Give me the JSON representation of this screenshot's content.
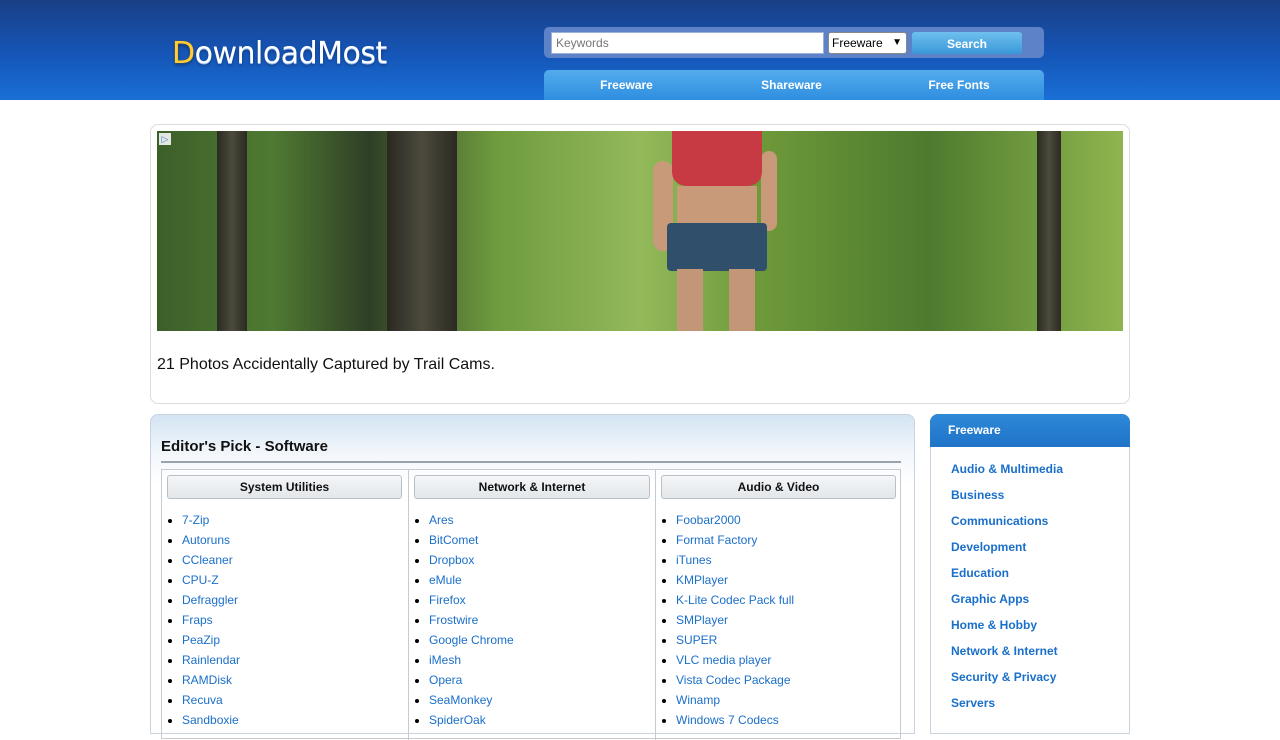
{
  "header": {
    "logo_text": "DownloadMost",
    "search": {
      "placeholder": "Keywords",
      "select_value": "Freeware",
      "button_label": "Search"
    },
    "nav": [
      "Freeware",
      "Shareware",
      "Free Fonts"
    ]
  },
  "ad": {
    "choices_icon": "ad-choices-icon",
    "caption": "21 Photos Accidentally Captured by Trail Cams."
  },
  "editors_pick": {
    "title": "Editor's Pick - Software",
    "columns": [
      {
        "heading": "System Utilities",
        "items": [
          "7-Zip",
          "Autoruns",
          "CCleaner",
          "CPU-Z",
          "Defraggler",
          "Fraps",
          "PeaZip",
          "Rainlendar",
          "RAMDisk",
          "Recuva",
          "Sandboxie"
        ]
      },
      {
        "heading": "Network & Internet",
        "items": [
          "Ares",
          "BitComet",
          "Dropbox",
          "eMule",
          "Firefox",
          "Frostwire",
          "Google Chrome",
          "iMesh",
          "Opera",
          "SeaMonkey",
          "SpiderOak"
        ]
      },
      {
        "heading": "Audio & Video",
        "items": [
          "Foobar2000",
          "Format Factory",
          "iTunes",
          "KMPlayer",
          "K-Lite Codec Pack full",
          "SMPlayer",
          "SUPER",
          "VLC media player",
          "Vista Codec Package",
          "Winamp",
          "Windows 7 Codecs"
        ]
      }
    ]
  },
  "freeware": {
    "title": "Freeware",
    "categories": [
      "Audio & Multimedia",
      "Business",
      "Communications",
      "Development",
      "Education",
      "Graphic Apps",
      "Home & Hobby",
      "Network & Internet",
      "Security & Privacy",
      "Servers"
    ]
  },
  "colors": {
    "header_blue": "#1556b8",
    "nav_blue": "#2e8ee0",
    "link_blue": "#1a6fc9"
  }
}
